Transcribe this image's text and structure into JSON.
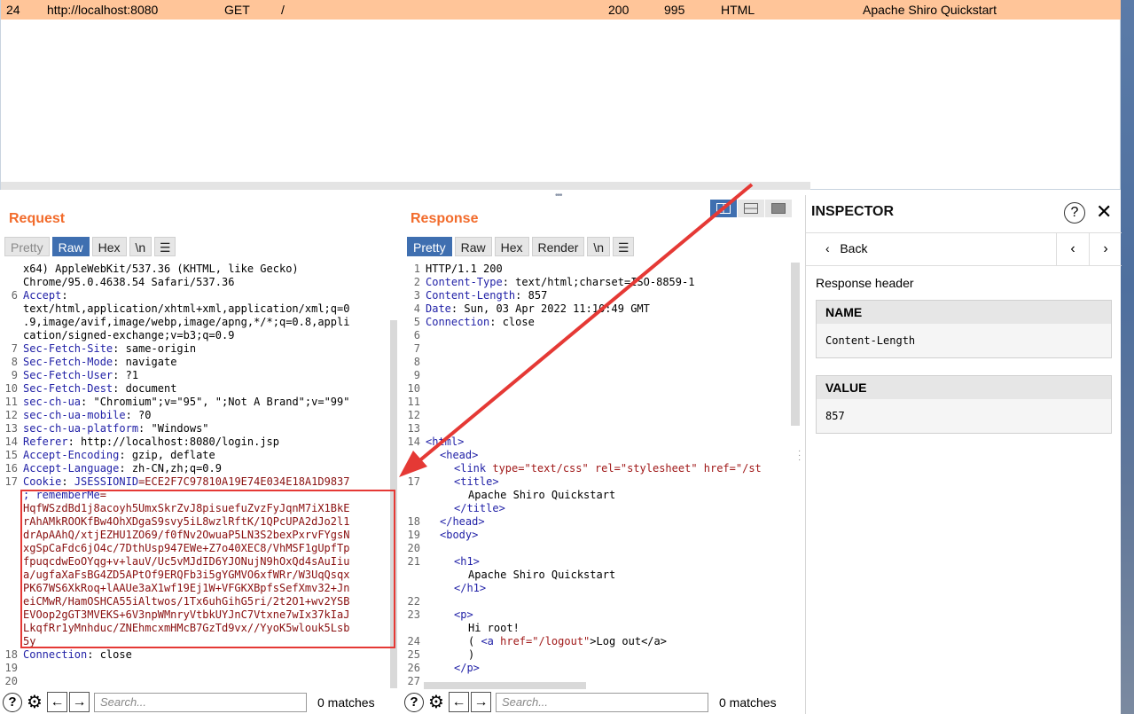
{
  "history": {
    "row": {
      "num": "24",
      "host": "http://localhost:8080",
      "method": "GET",
      "url": "/",
      "status": "200",
      "length": "995",
      "mime": "HTML",
      "title": "Apache Shiro Quickstart"
    }
  },
  "request": {
    "title": "Request",
    "tabs": [
      "Pretty",
      "Raw",
      "Hex",
      "\\n"
    ],
    "lines": [
      {
        "n": "",
        "t": "x64) AppleWebKit/537.36 (KHTML, like Gecko)"
      },
      {
        "n": "",
        "t": "Chrome/95.0.4638.54 Safari/537.36"
      },
      {
        "n": "6",
        "k": "Accept",
        "t": ""
      },
      {
        "n": "",
        "t": "text/html,application/xhtml+xml,application/xml;q=0"
      },
      {
        "n": "",
        "t": ".9,image/avif,image/webp,image/apng,*/*;q=0.8,appli"
      },
      {
        "n": "",
        "t": "cation/signed-exchange;v=b3;q=0.9"
      },
      {
        "n": "7",
        "k": "Sec-Fetch-Site",
        "t": " same-origin"
      },
      {
        "n": "8",
        "k": "Sec-Fetch-Mode",
        "t": " navigate"
      },
      {
        "n": "9",
        "k": "Sec-Fetch-User",
        "t": " ?1"
      },
      {
        "n": "10",
        "k": "Sec-Fetch-Dest",
        "t": " document"
      },
      {
        "n": "11",
        "k": "sec-ch-ua",
        "t": " \"Chromium\";v=\"95\", \";Not A Brand\";v=\"99\""
      },
      {
        "n": "12",
        "k": "sec-ch-ua-mobile",
        "t": " ?0"
      },
      {
        "n": "13",
        "k": "sec-ch-ua-platform",
        "t": " \"Windows\""
      },
      {
        "n": "14",
        "k": "Referer",
        "t": " http://localhost:8080/login.jsp"
      },
      {
        "n": "15",
        "k": "Accept-Encoding",
        "t": " gzip, deflate"
      },
      {
        "n": "16",
        "k": "Accept-Language",
        "t": " zh-CN,zh;q=0.9"
      },
      {
        "n": "17",
        "k": "Cookie",
        "t": "",
        "ck": " JSESSIONID",
        "cv": "=ECE2F7C97810A19E74E034E18A1D9837"
      },
      {
        "n": "",
        "ck": "; rememberMe",
        "cv": "="
      },
      {
        "n": "",
        "cv": "HqfWSzdBd1j8acoyh5UmxSkrZvJ8pisuefuZvzFyJqnM7iX1BkE"
      },
      {
        "n": "",
        "cv": "rAhAMkROOKfBw4OhXDgaS9svy5iL8wzlRftK/1QPcUPA2dJo2l1"
      },
      {
        "n": "",
        "cv": "drApAAhQ/xtjEZHU1ZO69/f0fNv2OwuaP5LN3S2bexPxrvFYgsN"
      },
      {
        "n": "",
        "cv": "xgSpCaFdc6jO4c/7DthUsp947EWe+Z7o40XEC8/VhMSF1gUpfTp"
      },
      {
        "n": "",
        "cv": "fpuqcdwEoOYqg+v+lauV/Uc5vMJdID6YJONujN9hOxQd4sAuIiu"
      },
      {
        "n": "",
        "cv": "a/ugfaXaFsBG4ZD5APtOf9ERQFb3i5gYGMVO6xfWRr/W3UqQsqx"
      },
      {
        "n": "",
        "cv": "PK67WS6XkRoq+lAAUe3aX1wf19Ej1W+VFGKXBpfsSefXmv32+Jn"
      },
      {
        "n": "",
        "cv": "eiCMwR/HamOSHCA55iAltwos/1Tx6uhGihG5ri/2t2O1+wv2YSB"
      },
      {
        "n": "",
        "cv": "EVOop2gGT3MVEKS+6V3npWMnryVtbkUYJnC7Vtxne7wIx37kIaJ"
      },
      {
        "n": "",
        "cv": "LkqfRr1yMnhduc/ZNEhmcxmHMcB7GzTd9vx//YyoK5wlouk5Lsb"
      },
      {
        "n": "",
        "cv": "5y"
      },
      {
        "n": "18",
        "k": "Connection",
        "t": " close"
      },
      {
        "n": "19",
        "t": ""
      },
      {
        "n": "20",
        "t": ""
      }
    ],
    "search_placeholder": "Search...",
    "matches": "0 matches"
  },
  "response": {
    "title": "Response",
    "tabs": [
      "Pretty",
      "Raw",
      "Hex",
      "Render",
      "\\n"
    ],
    "header_lines": [
      {
        "n": "1",
        "t": "HTTP/1.1 200"
      },
      {
        "n": "2",
        "k": "Content-Type",
        "t": " text/html;charset=ISO-8859-1"
      },
      {
        "n": "3",
        "k": "Content-Length",
        "t": " 857"
      },
      {
        "n": "4",
        "k": "Date",
        "t": " Sun, 03 Apr 2022 11:10:49 GMT"
      },
      {
        "n": "5",
        "k": "Connection",
        "t": " close"
      },
      {
        "n": "6",
        "t": ""
      },
      {
        "n": "7",
        "t": ""
      },
      {
        "n": "8",
        "t": ""
      },
      {
        "n": "9",
        "t": ""
      },
      {
        "n": "10",
        "t": ""
      },
      {
        "n": "11",
        "t": ""
      },
      {
        "n": "12",
        "t": ""
      },
      {
        "n": "13",
        "t": ""
      }
    ],
    "body_lines": [
      {
        "n": "14",
        "h": "<html>",
        "indent": 0
      },
      {
        "n": "",
        "h": "<head>",
        "indent": 1
      },
      {
        "n": "",
        "h": "<link",
        "a": " type=\"text/css\" rel=\"stylesheet\" href=\"/st",
        "indent": 2
      },
      {
        "n": "17",
        "h": "<title>",
        "indent": 2
      },
      {
        "n": "",
        "t": "Apache Shiro Quickstart",
        "indent": 3
      },
      {
        "n": "",
        "h": "</title>",
        "indent": 2
      },
      {
        "n": "18",
        "h": "</head>",
        "indent": 1
      },
      {
        "n": "19",
        "h": "<body>",
        "indent": 1
      },
      {
        "n": "20",
        "t": "",
        "indent": 0
      },
      {
        "n": "21",
        "h": "<h1>",
        "indent": 2
      },
      {
        "n": "",
        "t": "Apache Shiro Quickstart",
        "indent": 3
      },
      {
        "n": "",
        "h": "</h1>",
        "indent": 2
      },
      {
        "n": "22",
        "t": "",
        "indent": 0
      },
      {
        "n": "23",
        "h": "<p>",
        "indent": 2
      },
      {
        "n": "",
        "t": "Hi root!",
        "indent": 3
      },
      {
        "n": "24",
        "t": "( ",
        "h": "<a",
        "a": " href=\"/logout\"",
        "t2": ">Log out</a>",
        "indent": 3
      },
      {
        "n": "25",
        "t": ")",
        "indent": 3
      },
      {
        "n": "26",
        "h": "</p>",
        "indent": 2
      },
      {
        "n": "27",
        "t": "",
        "indent": 0
      }
    ],
    "search_placeholder": "Search...",
    "matches": "0 matches"
  },
  "inspector": {
    "title": "INSPECTOR",
    "back_label": "Back",
    "section": "Response header",
    "name_label": "NAME",
    "name_value": "Content-Length",
    "value_label": "VALUE",
    "value_value": "857"
  }
}
